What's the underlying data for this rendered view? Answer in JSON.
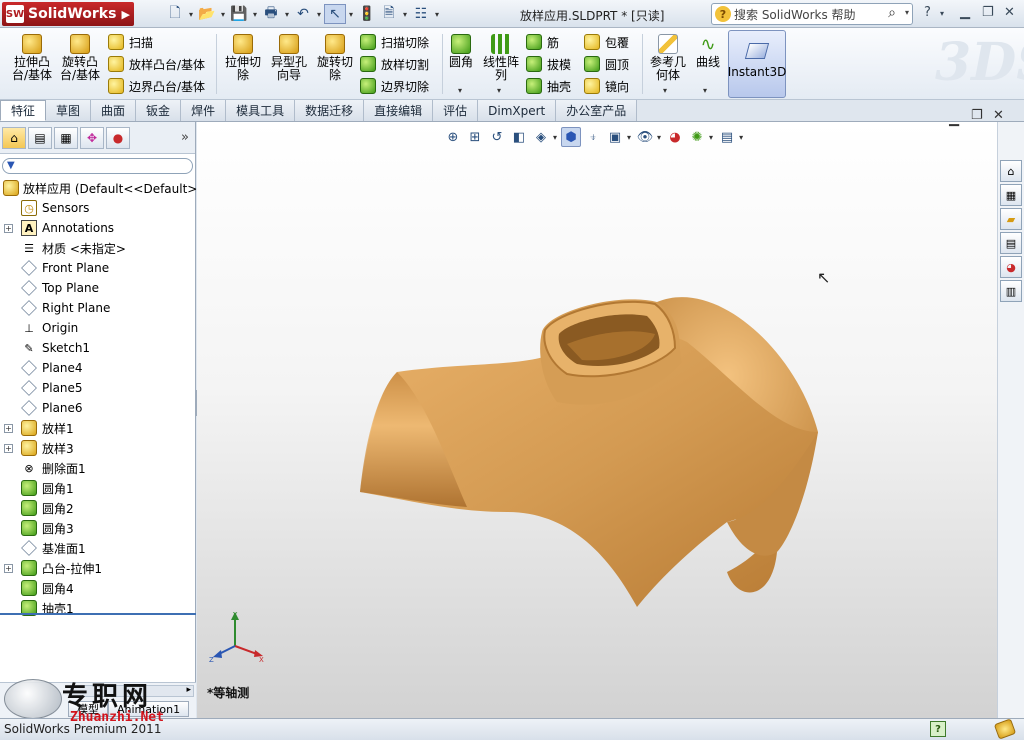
{
  "app": {
    "logo_text": "SolidWorks",
    "document_title": "放样应用.SLDPRT * [只读]",
    "search_placeholder": "搜索 SolidWorks 帮助",
    "status_text": "SolidWorks Premium 2011"
  },
  "ribbon": {
    "big": [
      {
        "label": "拉伸凸\n台/基体",
        "icon": "extrude-boss-icon"
      },
      {
        "label": "旋转凸\n台/基体",
        "icon": "revolve-boss-icon"
      },
      {
        "label": "拉伸切\n除",
        "icon": "extrude-cut-icon"
      },
      {
        "label": "异型孔\n向导",
        "icon": "hole-wizard-icon"
      },
      {
        "label": "旋转切\n除",
        "icon": "revolve-cut-icon"
      },
      {
        "label": "圆角",
        "icon": "fillet-icon"
      },
      {
        "label": "线性阵\n列",
        "icon": "linear-pattern-icon"
      },
      {
        "label": "参考几\n何体",
        "icon": "reference-geometry-icon"
      },
      {
        "label": "曲线",
        "icon": "curves-icon"
      }
    ],
    "small": [
      {
        "label": "扫描"
      },
      {
        "label": "放样凸台/基体"
      },
      {
        "label": "边界凸台/基体"
      },
      {
        "label": "扫描切除"
      },
      {
        "label": "放样切割"
      },
      {
        "label": "边界切除"
      },
      {
        "label": "筋"
      },
      {
        "label": "拔模"
      },
      {
        "label": "抽壳"
      },
      {
        "label": "包覆"
      },
      {
        "label": "圆顶"
      },
      {
        "label": "镜向"
      }
    ],
    "instant3d": "Instant3D"
  },
  "tabs": [
    "特征",
    "草图",
    "曲面",
    "钣金",
    "焊件",
    "模具工具",
    "数据迁移",
    "直接编辑",
    "评估",
    "DimXpert",
    "办公室产品"
  ],
  "tree": {
    "root": "放样应用 (Default<<Default>",
    "items": [
      {
        "label": "Sensors",
        "icon": "sensor-icon",
        "expand": false
      },
      {
        "label": "Annotations",
        "icon": "annotations-icon",
        "expand": true
      },
      {
        "label": "材质 <未指定>",
        "icon": "material-icon",
        "expand": false
      },
      {
        "label": "Front Plane",
        "icon": "plane-icon",
        "expand": false
      },
      {
        "label": "Top Plane",
        "icon": "plane-icon",
        "expand": false
      },
      {
        "label": "Right Plane",
        "icon": "plane-icon",
        "expand": false
      },
      {
        "label": "Origin",
        "icon": "origin-icon",
        "expand": false
      },
      {
        "label": "Sketch1",
        "icon": "sketch-icon",
        "expand": false
      },
      {
        "label": "Plane4",
        "icon": "plane-icon",
        "expand": false
      },
      {
        "label": "Plane5",
        "icon": "plane-icon",
        "expand": false
      },
      {
        "label": "Plane6",
        "icon": "plane-icon",
        "expand": false
      },
      {
        "label": "放样1",
        "icon": "loft-icon",
        "expand": true
      },
      {
        "label": "放样3",
        "icon": "loft-icon",
        "expand": true
      },
      {
        "label": "删除面1",
        "icon": "delete-face-icon",
        "expand": false
      },
      {
        "label": "圆角1",
        "icon": "fillet-icon",
        "expand": false
      },
      {
        "label": "圆角2",
        "icon": "fillet-icon",
        "expand": false
      },
      {
        "label": "圆角3",
        "icon": "fillet-icon",
        "expand": false
      },
      {
        "label": "基准面1",
        "icon": "plane-icon",
        "expand": false
      },
      {
        "label": "凸台-拉伸1",
        "icon": "extrude-icon",
        "expand": true
      },
      {
        "label": "圆角4",
        "icon": "fillet-icon",
        "expand": false
      },
      {
        "label": "抽壳1",
        "icon": "shell-icon",
        "expand": false
      }
    ]
  },
  "bottom_tabs": [
    "模型",
    "Animation1"
  ],
  "viewport": {
    "view_label": "*等轴测",
    "triad": {
      "x": "X",
      "y": "Y",
      "z": "Z"
    }
  },
  "watermark": {
    "cn": "专职网",
    "en": "Zhuanzhi.Net"
  },
  "colors": {
    "model": "#d9a05a",
    "accent": "#c8292b"
  }
}
